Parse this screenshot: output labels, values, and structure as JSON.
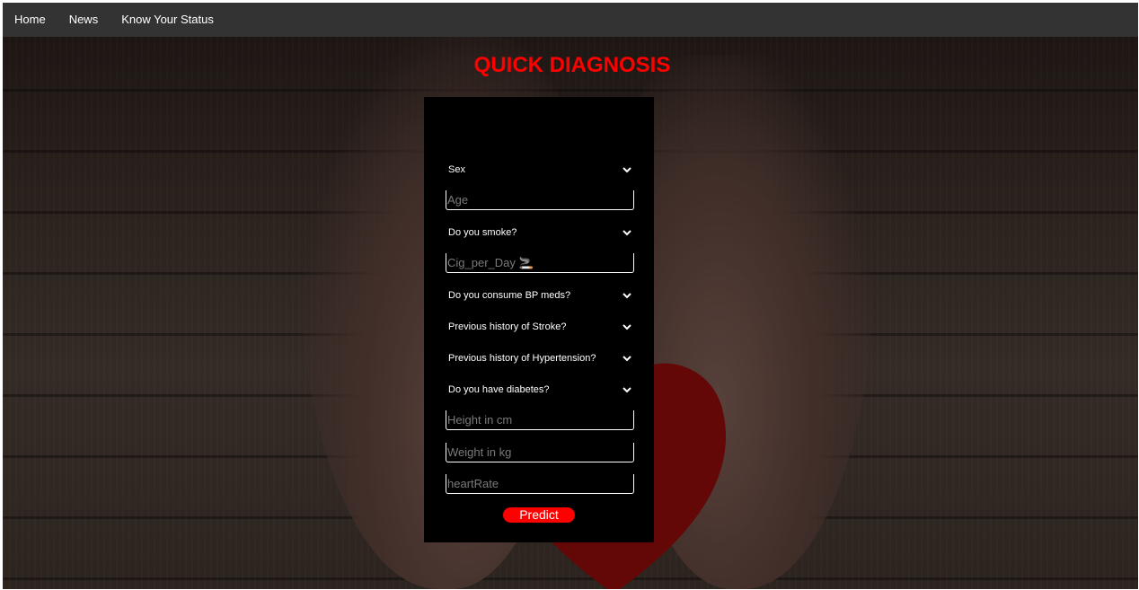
{
  "nav": {
    "items": [
      "Home",
      "News",
      "Know Your Status"
    ]
  },
  "page": {
    "title": "QUICK DIAGNOSIS"
  },
  "form": {
    "sex_select": "Sex",
    "age_placeholder": "Age",
    "smoke_select": "Do you smoke?",
    "cig_placeholder": "Cig_per_Day 🚬",
    "bp_meds_select": "Do you consume BP meds?",
    "stroke_select": "Previous history of Stroke?",
    "hypertension_select": "Previous history of Hypertension?",
    "diabetes_select": "Do you have diabetes?",
    "height_placeholder": "Height in cm",
    "weight_placeholder": "Weight in kg",
    "heartrate_placeholder": "heartRate",
    "predict_label": "Predict"
  },
  "colors": {
    "accent": "#ff0000",
    "navbar": "#333333",
    "card": "#000000"
  },
  "icons": {
    "dropdown": "chevron-down-icon"
  }
}
